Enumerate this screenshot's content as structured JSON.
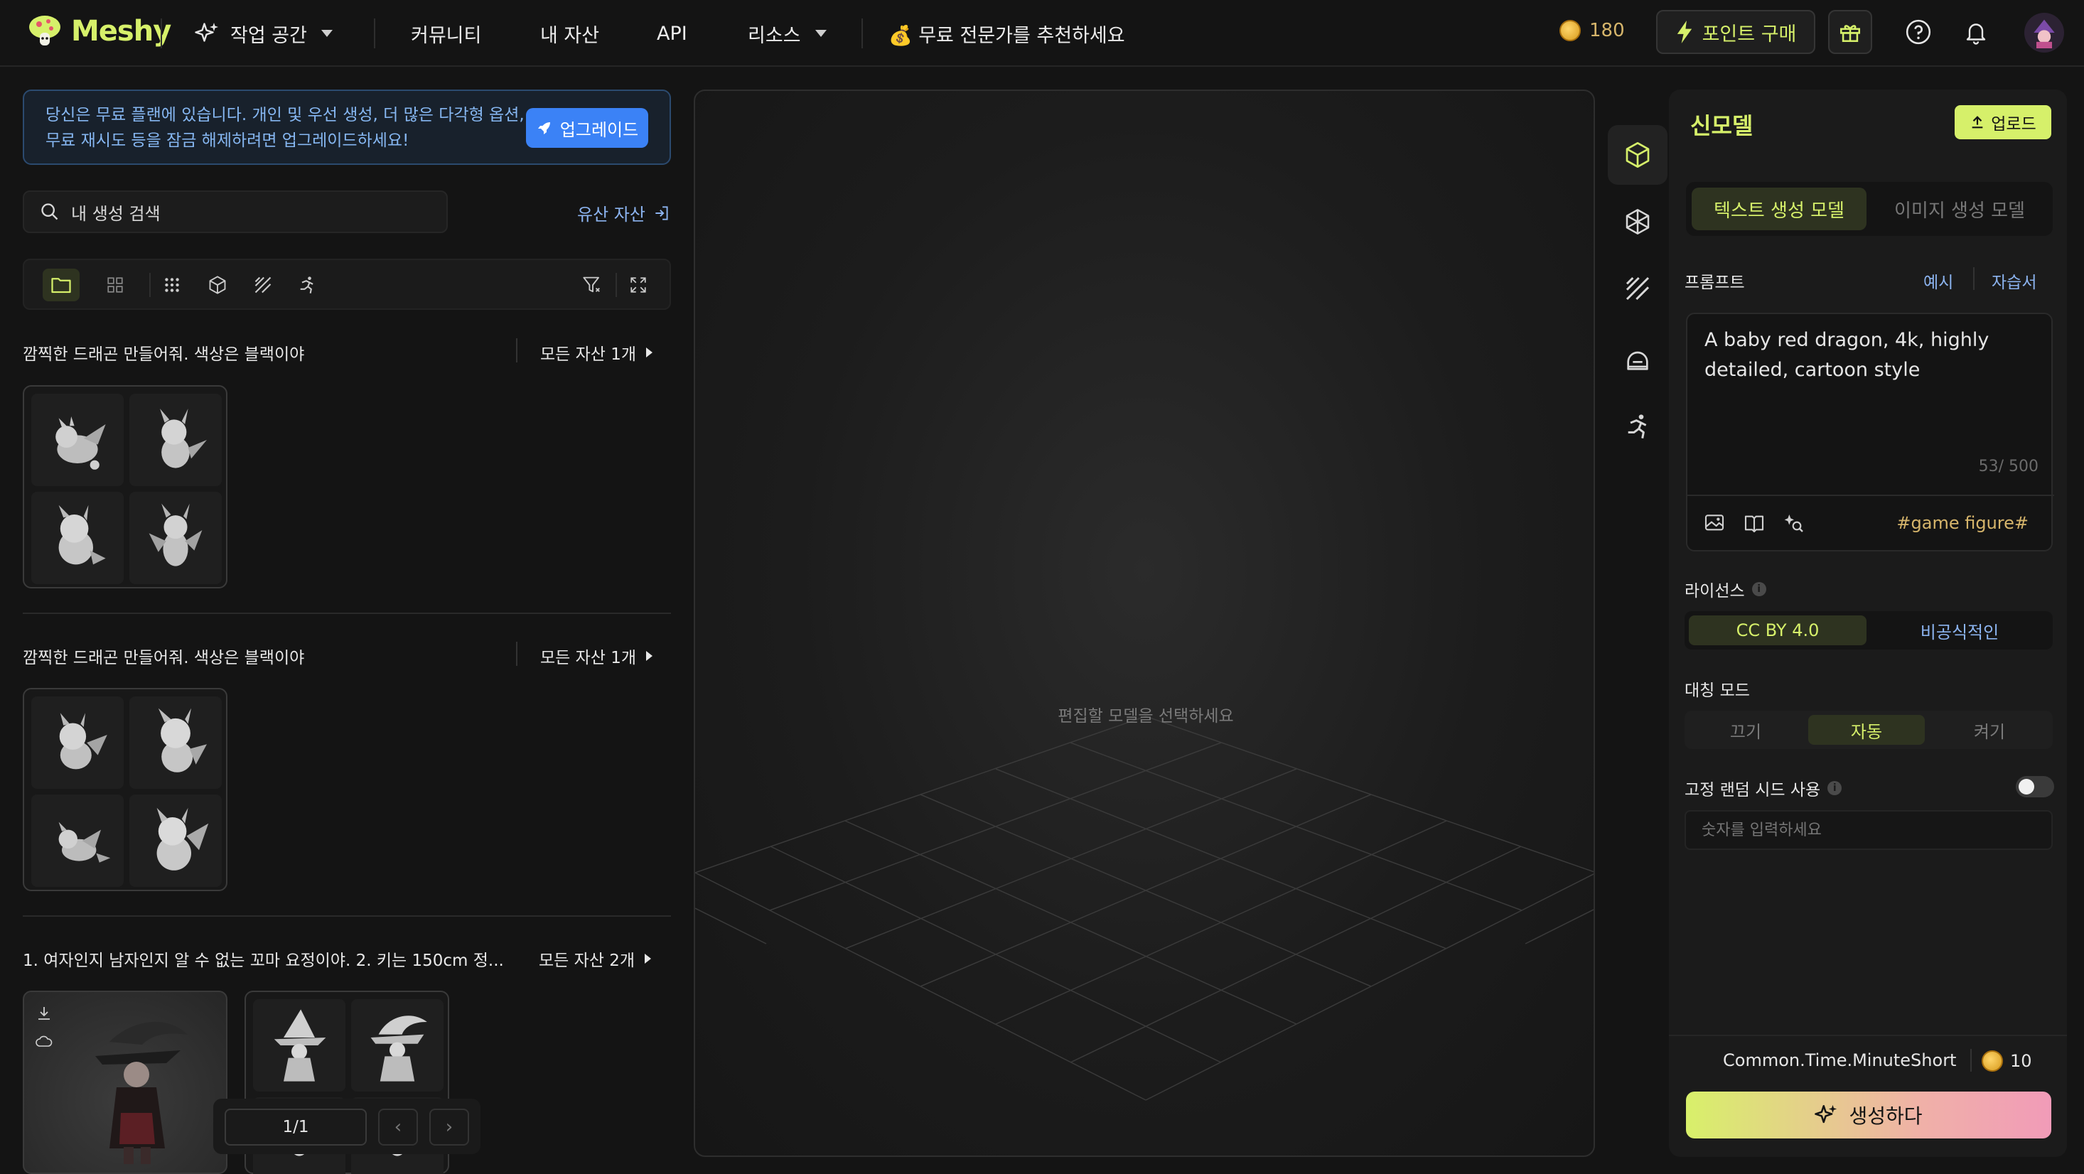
{
  "nav": {
    "brand": "Meshy",
    "workspace": "작업 공간",
    "community": "커뮤니티",
    "my_assets": "내 자산",
    "api": "API",
    "resources": "리소스",
    "refer": "💰 무료 전문가를 추천하세요",
    "credits": "180",
    "buy_points": "포인트 구매"
  },
  "banner": {
    "text": "당신은 무료 플랜에 있습니다. 개인 및 우선 생성, 더 많은 다각형 옵션, 무료 재시도 등을 잠금 해제하려면 업그레이드하세요!",
    "button": "업그레이드"
  },
  "search": {
    "placeholder": "내 생성 검색",
    "legacy_link": "유산 자산"
  },
  "groups": [
    {
      "title": "깜찍한 드래곤 만들어줘. 색상은 블랙이야",
      "link": "모든 자산 1개"
    },
    {
      "title": "깜찍한 드래곤 만들어줘. 색상은 블랙이야",
      "link": "모든 자산 1개"
    },
    {
      "title": "1. 여자인지 남자인지 알 수 없는 꼬마 요정이야. 2. 키는 150cm 정...",
      "link": "모든 자산 2개"
    }
  ],
  "pager": {
    "value": "1/1",
    "prev": "‹",
    "next": "›"
  },
  "viewport": {
    "hint": "편집할 모델을 선택하세요"
  },
  "panel": {
    "title": "신모델",
    "upload": "업로드",
    "tab_text": "텍스트 생성 모델",
    "tab_image": "이미지 생성 모델",
    "prompt_label": "프롬프트",
    "examples": "예시",
    "tutorial": "자습서",
    "prompt_text": "A baby red dragon, 4k, highly detailed, cartoon style",
    "char_count": "53/ 500",
    "tag": "#game figure#",
    "license_label": "라이선스",
    "license_cc": "CC BY 4.0",
    "license_nc": "비공식적인",
    "symmetry_label": "대칭 모드",
    "sym_off": "끄기",
    "sym_auto": "자동",
    "sym_on": "켜기",
    "seed_label": "고정 랜덤 시드 사용",
    "seed_placeholder": "숫자를 입력하세요",
    "time": "Common.Time.MinuteShort",
    "cost": "10",
    "generate": "생성하다"
  },
  "colors": {
    "accent": "#d6f06a",
    "link": "#8cb4f0",
    "banner_btn": "#3b82f6",
    "background": "#141414"
  }
}
